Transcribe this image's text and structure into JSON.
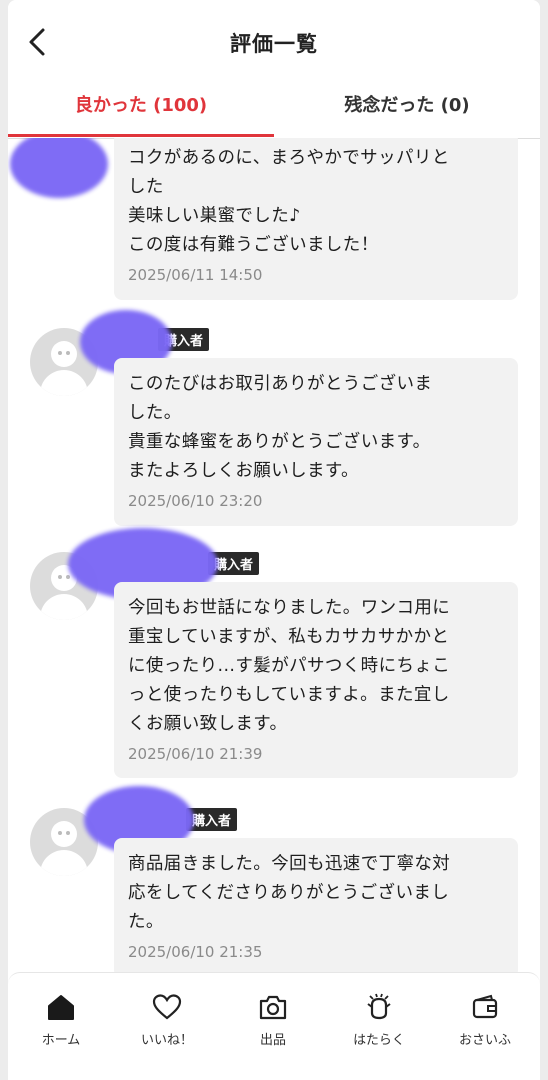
{
  "header": {
    "title": "評価一覧"
  },
  "tabs": [
    {
      "label": "良かった (100)"
    },
    {
      "label": "残念だった (0)"
    }
  ],
  "reviews": [
    {
      "badge": "",
      "comment": "コクがあるのに、まろやかでサッパリと\nした\n美味しい巣蜜でした♪\nこの度は有難うございました！",
      "date": "2025/06/11 14:50"
    },
    {
      "badge": "購入者",
      "comment": "このたびはお取引ありがとうございま\nした。\n貴重な蜂蜜をありがとうございます。\nまたよろしくお願いします。",
      "date": "2025/06/10 23:20"
    },
    {
      "badge": "購入者",
      "comment": "今回もお世話になりました。ワンコ用に\n重宝していますが、私もカサカサかかと\nに使ったり...す髪がパサつく時にちょこ\nっと使ったりもしていますよ。また宜し\nくお願い致します。",
      "date": "2025/06/10 21:39"
    },
    {
      "badge": "購入者",
      "comment": "商品届きました。今回も迅速で丁寧な対\n応をしてくださりありがとうございまし\nた。",
      "date": "2025/06/10 21:35"
    }
  ],
  "bottom_nav": [
    {
      "label": "ホーム",
      "icon": "home-icon"
    },
    {
      "label": "いいね！",
      "icon": "heart-icon"
    },
    {
      "label": "出品",
      "icon": "camera-icon"
    },
    {
      "label": "はたらく",
      "icon": "work-icon"
    },
    {
      "label": "おさいふ",
      "icon": "wallet-icon"
    }
  ],
  "colors": {
    "accent": "#e0353b",
    "redaction": "#7b68f5",
    "bubble": "#f2f2f2"
  }
}
